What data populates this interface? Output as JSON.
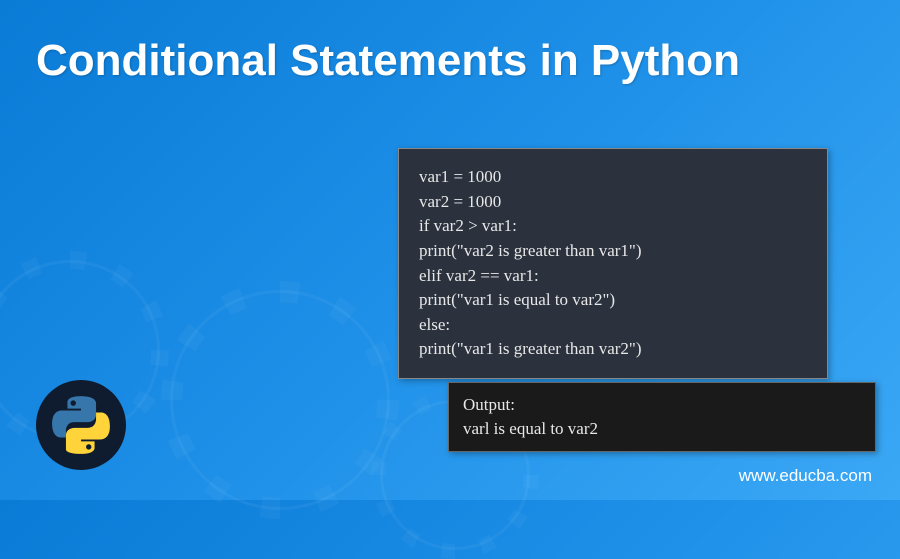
{
  "title": "Conditional Statements in Python",
  "code": {
    "line1": "var1 = 1000",
    "line2": "var2 = 1000",
    "line3": "if var2 > var1:",
    "line4": "print(\"var2 is greater than var1\")",
    "line5": "elif var2 == var1:",
    "line6": "print(\"var1 is equal to var2\")",
    "line7": "else:",
    "line8": "print(\"var1 is greater than var2\")"
  },
  "output": {
    "label": "Output:",
    "result": "varl is equal to var2"
  },
  "footer": "www.educba.com",
  "logo_name": "python-logo"
}
